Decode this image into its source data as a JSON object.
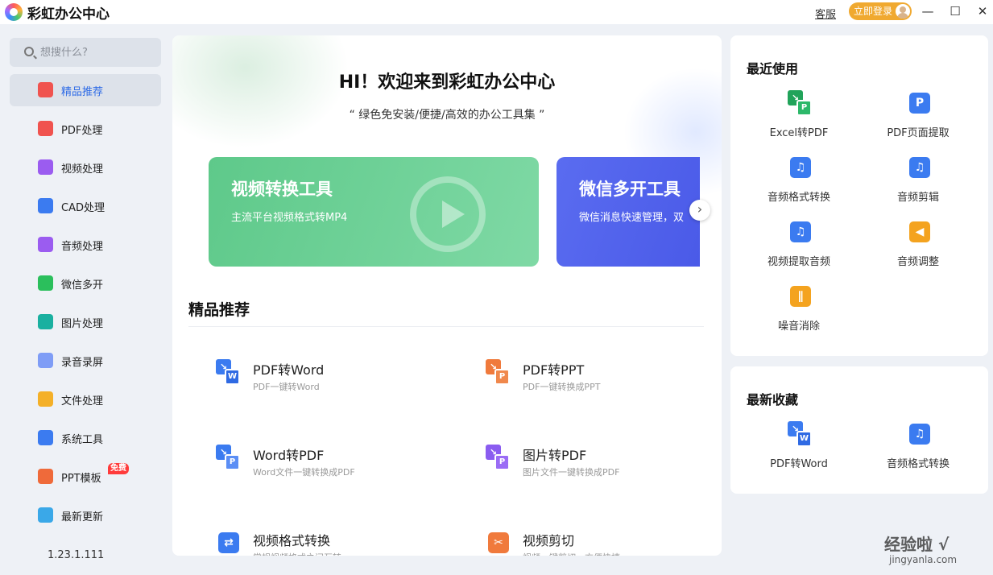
{
  "app": {
    "title": "彩虹办公中心"
  },
  "titlebar": {
    "service": "客服",
    "login": "立即登录",
    "minimize": "—",
    "maximize": "☐",
    "close": "✕"
  },
  "search": {
    "placeholder": "想搜什么?"
  },
  "sidebar": {
    "items": [
      {
        "label": "精品推荐",
        "icon": "thumbs-up-icon",
        "color": "#f0534f"
      },
      {
        "label": "PDF处理",
        "icon": "pdf-icon",
        "color": "#f0534f"
      },
      {
        "label": "视频处理",
        "icon": "video-icon",
        "color": "#9b5cf0"
      },
      {
        "label": "CAD处理",
        "icon": "cad-icon",
        "color": "#3b7bf0"
      },
      {
        "label": "音频处理",
        "icon": "music-icon",
        "color": "#9b5cf0"
      },
      {
        "label": "微信多开",
        "icon": "wechat-icon",
        "color": "#2bbf5c"
      },
      {
        "label": "图片处理",
        "icon": "image-icon",
        "color": "#1ab0a0"
      },
      {
        "label": "录音录屏",
        "icon": "microphone-icon",
        "color": "#7f9df6"
      },
      {
        "label": "文件处理",
        "icon": "folder-icon",
        "color": "#f4b028"
      },
      {
        "label": "系统工具",
        "icon": "gear-icon",
        "color": "#3b7bf0"
      },
      {
        "label": "PPT模板",
        "icon": "ppt-icon",
        "color": "#ef6a3a"
      },
      {
        "label": "最新更新",
        "icon": "update-icon",
        "color": "#3aa8e8"
      }
    ],
    "free_badge": "免费",
    "version": "1.23.1.111"
  },
  "main": {
    "welcome": "HI！欢迎来到彩虹办公中心",
    "subtitle": "“ 绿色免安装/便捷/高效的办公工具集 ”",
    "banners": [
      {
        "title": "视频转换工具",
        "subtitle": "主流平台视频格式转MP4"
      },
      {
        "title": "微信多开工具",
        "subtitle": "微信消息快速管理，双"
      }
    ],
    "section_title": "精品推荐",
    "tools": [
      {
        "title": "PDF转Word",
        "desc": "PDF一键转Word"
      },
      {
        "title": "PDF转PPT",
        "desc": "PDF一键转换成PPT"
      },
      {
        "title": "Word转PDF",
        "desc": "Word文件一键转换成PDF"
      },
      {
        "title": "图片转PDF",
        "desc": "图片文件一键转换成PDF"
      },
      {
        "title": "视频格式转换",
        "desc": "常规视频格式之间互转"
      },
      {
        "title": "视频剪切",
        "desc": "视频一键剪切，方便快捷"
      }
    ]
  },
  "recent": {
    "title": "最近使用",
    "items": [
      "Excel转PDF",
      "PDF页面提取",
      "音频格式转换",
      "音频剪辑",
      "视频提取音频",
      "音频调整",
      "噪音消除"
    ]
  },
  "favorites": {
    "title": "最新收藏",
    "items": [
      "PDF转Word",
      "音频格式转换"
    ]
  },
  "watermark": {
    "text": "经验啦 √",
    "sub": "jingyanla.com"
  }
}
